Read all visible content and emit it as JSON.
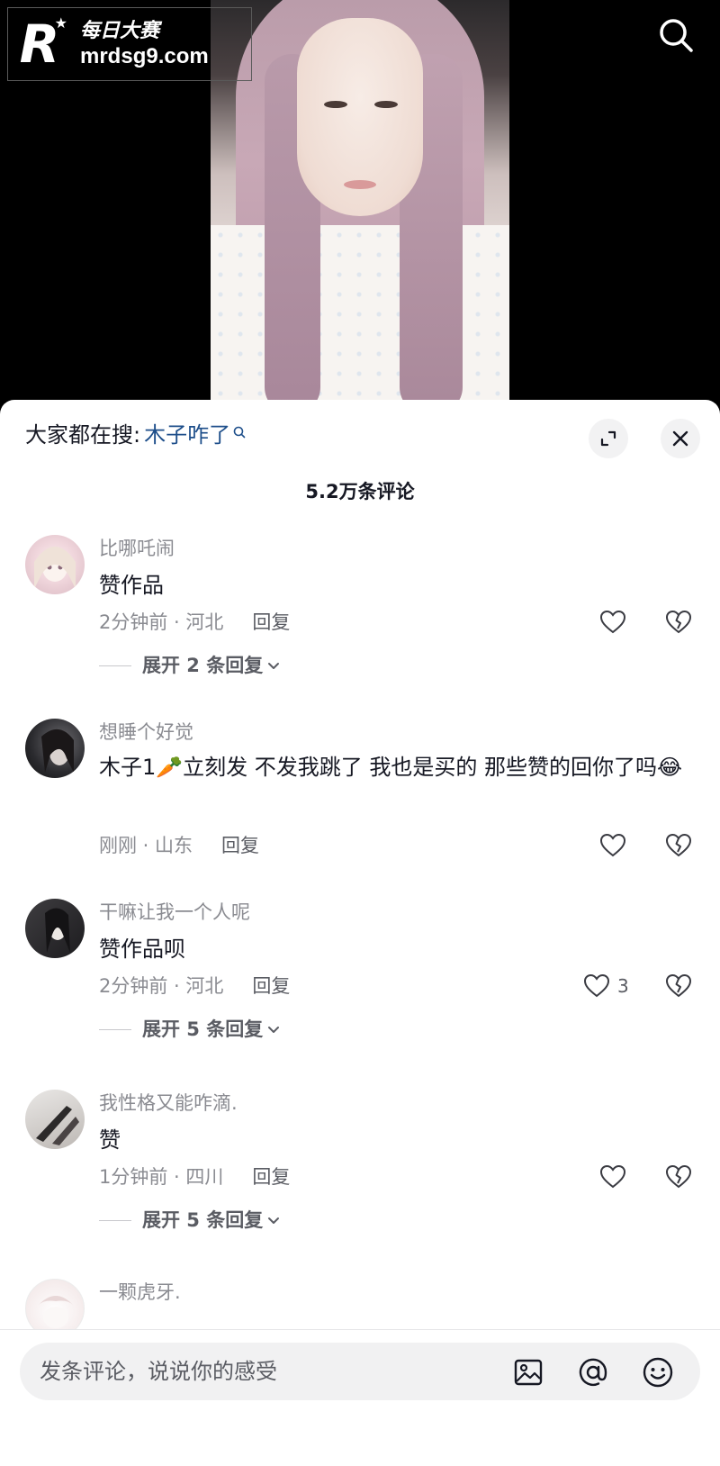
{
  "watermark": {
    "cn": "每日大赛",
    "url": "mrdsg9.com",
    "mark": "R"
  },
  "top_icons": {
    "search": "search-icon"
  },
  "sheet": {
    "hot_search_prefix": "大家都在搜:",
    "hot_search_keyword": "木子咋了",
    "comment_count": "5.2万条评论"
  },
  "comments": [
    {
      "username": "比哪吒闹",
      "text": "赞作品",
      "time": "2分钟前 · 河北",
      "reply": "回复",
      "likes": "",
      "expand": "展开 2 条回复"
    },
    {
      "username": "想睡个好觉",
      "text": "木子1🥕立刻发 不发我跳了 我也是买的 那些赞的回你了吗😂",
      "time": "刚刚 · 山东",
      "reply": "回复",
      "likes": "",
      "expand": ""
    },
    {
      "username": "干嘛让我一个人呢",
      "text": "赞作品呗",
      "time": "2分钟前 · 河北",
      "reply": "回复",
      "likes": "3",
      "expand": "展开 5 条回复"
    },
    {
      "username": "我性格又能咋滴.",
      "text": "赞",
      "time": "1分钟前 · 四川",
      "reply": "回复",
      "likes": "",
      "expand": "展开 5 条回复"
    },
    {
      "username": "一颗虎牙.",
      "text": "",
      "time": "",
      "reply": "",
      "likes": "",
      "expand": ""
    }
  ],
  "input": {
    "placeholder": "发条评论，说说你的感受",
    "icons": [
      "image-icon",
      "at-icon",
      "emoji-icon"
    ]
  }
}
